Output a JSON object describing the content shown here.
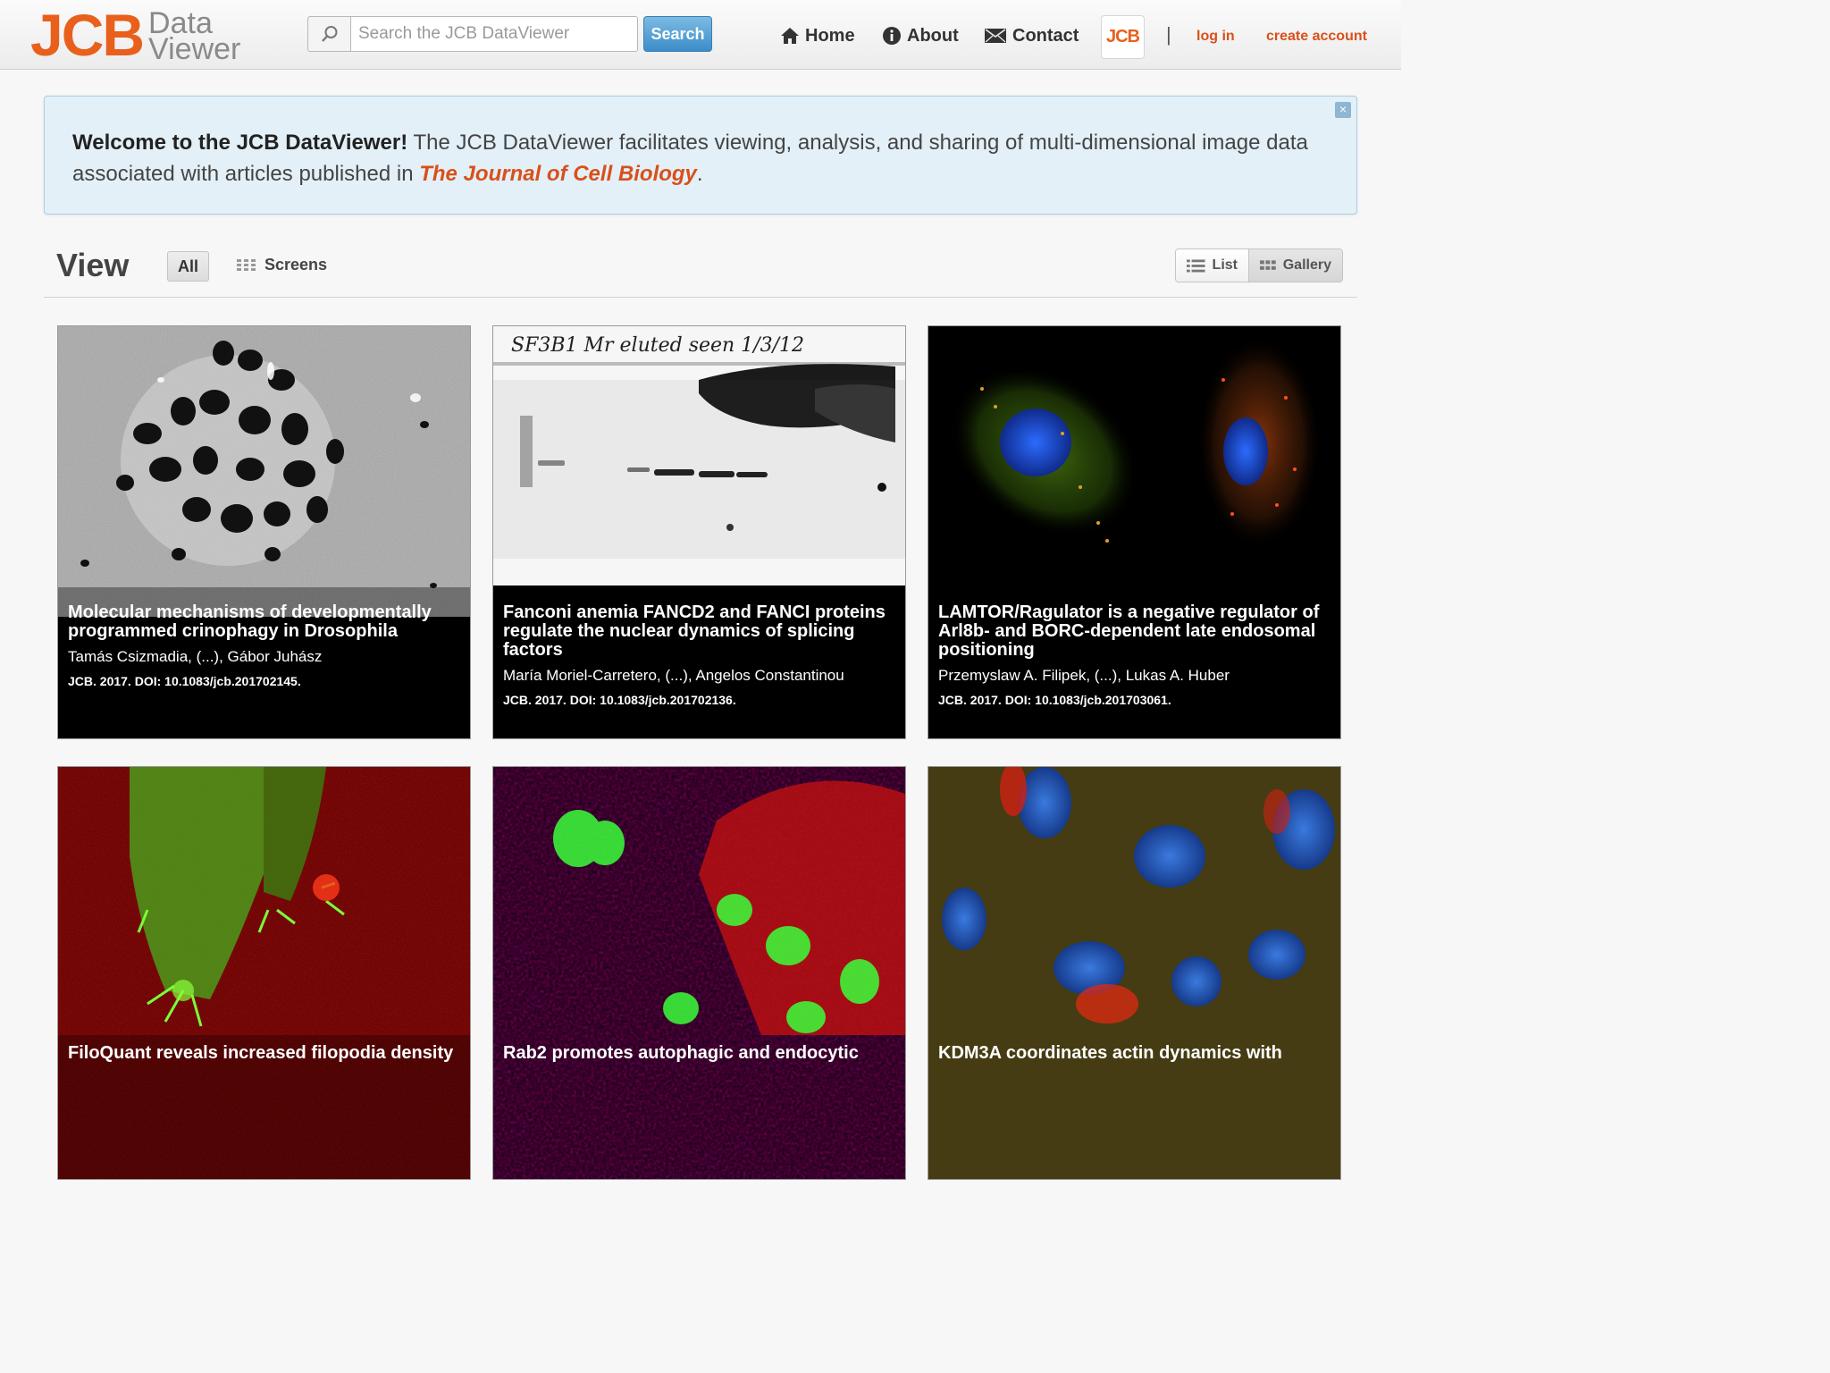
{
  "header": {
    "logo_main": "JCB",
    "logo_sub_1": "Data",
    "logo_sub_2": "Viewer",
    "search_placeholder": "Search the JCB DataViewer",
    "search_button": "Search",
    "nav": {
      "home": "Home",
      "about": "About",
      "contact": "Contact"
    },
    "jcb_badge": "JCB",
    "separator": "|",
    "login": "log in",
    "create_account": "create account"
  },
  "welcome": {
    "lead": "Welcome to the JCB DataViewer!",
    "body": " The JCB DataViewer facilitates viewing, analysis, and sharing of multi-dimensional image data associated with articles published in ",
    "journal": "The Journal of Cell Biology",
    "end": ".",
    "close": "×"
  },
  "view": {
    "title": "View",
    "filter_all": "All",
    "filter_screens": "Screens",
    "mode_list": "List",
    "mode_gallery": "Gallery"
  },
  "cards": [
    {
      "title": "Molecular mechanisms of developmentally programmed crinophagy in Drosophila",
      "authors": "Tamás Csizmadia, (...), Gábor Juhász",
      "doi": "JCB. 2017. DOI: 10.1083/jcb.201702145."
    },
    {
      "title": "Fanconi anemia FANCD2 and FANCI proteins regulate the nuclear dynamics of splicing factors",
      "authors": "María Moriel-Carretero, (...), Angelos Constantinou",
      "doi": "JCB. 2017. DOI: 10.1083/jcb.201702136.",
      "handwriting": "SF3B1 Mr eluted seen 1/3/12"
    },
    {
      "title": "LAMTOR/Ragulator is a negative regulator of Arl8b- and BORC-dependent late endosomal positioning",
      "authors": "Przemyslaw A. Filipek, (...), Lukas A. Huber",
      "doi": "JCB. 2017. DOI: 10.1083/jcb.201703061."
    },
    {
      "title": "FiloQuant reveals increased filopodia density"
    },
    {
      "title": "Rab2 promotes autophagic and endocytic"
    },
    {
      "title": "KDM3A coordinates actin dynamics with"
    }
  ],
  "colors": {
    "brand": "#e8601c",
    "link": "#d9501a",
    "alert_bg": "#e3f0f8",
    "primary_button": "#3c8dc9"
  }
}
